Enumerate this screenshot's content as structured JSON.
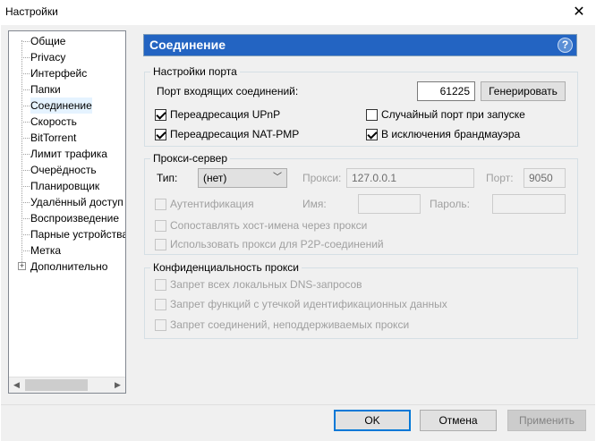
{
  "window": {
    "title": "Настройки"
  },
  "tree": {
    "items": [
      {
        "label": "Общие"
      },
      {
        "label": "Privacy"
      },
      {
        "label": "Интерфейс"
      },
      {
        "label": "Папки"
      },
      {
        "label": "Соединение"
      },
      {
        "label": "Скорость"
      },
      {
        "label": "BitTorrent"
      },
      {
        "label": "Лимит трафика"
      },
      {
        "label": "Очерёдность"
      },
      {
        "label": "Планировщик"
      },
      {
        "label": "Удалённый доступ"
      },
      {
        "label": "Воспроизведение"
      },
      {
        "label": "Парные устройства"
      },
      {
        "label": "Метка"
      },
      {
        "label": "Дополнительно"
      }
    ],
    "selected_index": 4,
    "expander_glyph": "+"
  },
  "header": {
    "title": "Соединение",
    "help_glyph": "?"
  },
  "port": {
    "group_title": "Настройки порта",
    "incoming_label": "Порт входящих соединений:",
    "port_value": "61225",
    "generate_label": "Генерировать",
    "upnp_label": "Переадресация UPnP",
    "natpmp_label": "Переадресация NAT-PMP",
    "random_label": "Случайный порт при запуске",
    "firewall_label": "В исключения брандмауэра"
  },
  "proxy": {
    "group_title": "Прокси-сервер",
    "type_label": "Тип:",
    "type_value": "(нет)",
    "proxy_label": "Прокси:",
    "proxy_value": "127.0.0.1",
    "port_label": "Порт:",
    "port_value": "9050",
    "auth_label": "Аутентификация",
    "name_label": "Имя:",
    "password_label": "Пароль:",
    "resolve_label": "Сопоставлять хост-имена через прокси",
    "p2p_label": "Использовать прокси для P2P-соединений"
  },
  "privacy": {
    "group_title": "Конфиденциальность прокси",
    "dns_label": "Запрет всех локальных DNS-запросов",
    "leak_label": "Запрет функций с утечкой идентификационных данных",
    "unsupported_label": "Запрет соединений, неподдерживаемых прокси"
  },
  "footer": {
    "ok_label": "OK",
    "cancel_label": "Отмена",
    "apply_label": "Применить"
  },
  "colors": {
    "header_bg": "#2364c2",
    "accent": "#0078d7"
  }
}
